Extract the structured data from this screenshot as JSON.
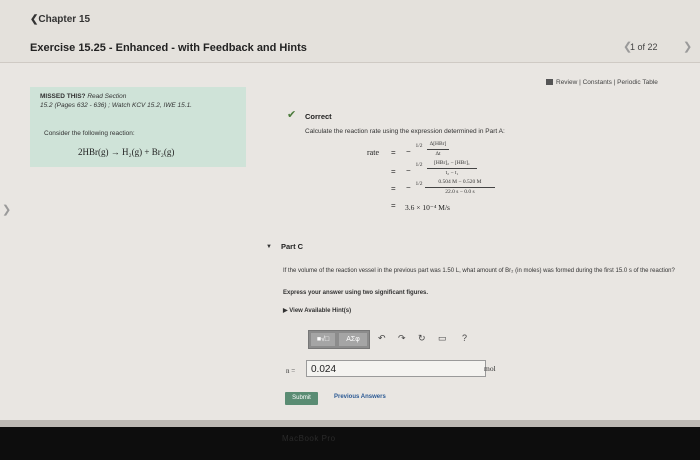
{
  "header": {
    "chapter": "❮Chapter 15",
    "title": "Exercise 15.25 - Enhanced - with Feedback and Hints",
    "pager": "1 of 22",
    "prev_arrow": "❮",
    "next_arrow": "❯"
  },
  "side_arrow": "❯",
  "review_link": "Review | Constants | Periodic Table",
  "missed": {
    "lead": "MISSED THIS?",
    "read": " Read Section",
    "detail": "15.2 (Pages 632 - 636) ; Watch KCV 15.2, IWE 15.1.",
    "consider": "Consider the following reaction:",
    "reaction": "2HBr(g) → H₂(g) + Br₂(g)"
  },
  "correct": {
    "heading": "Correct",
    "text": "Calculate the reaction rate using the expression determined in Part A:",
    "rate_label": "rate",
    "eq_sign": "=",
    "line1_coef": "−",
    "line1_num": "Δ[HBr]",
    "line1_den": "Δt",
    "line2_num": "[HBr]₂ − [HBr]₁",
    "line2_den": "t₂ − t₁",
    "line3_num": "0.504 M − 0.520 M",
    "line3_den": "22.0 s − 0.0 s",
    "result": "3.6 × 10⁻⁴ M/s",
    "half": "1/2"
  },
  "partc": {
    "label": "Part C",
    "question": "If the volume of the reaction vessel in the previous part was 1.50 L, what amount of Br₂ (in moles) was formed during the first 15.0 s of the reaction?",
    "express": "Express your answer using two significant figures.",
    "hints": "View Available Hint(s)",
    "toolbar_btn1": "■√□",
    "toolbar_btn2": "ΑΣφ",
    "undo_icon": "↶",
    "redo_icon": "↷",
    "reset_icon": "↻",
    "keyboard_icon": "▭",
    "help_icon": "?",
    "n_label": "n =",
    "answer_value": "0.024",
    "unit": "mol",
    "submit": "Submit",
    "previous_answers": "Previous Answers"
  },
  "bezel_text": "MacBook Pro"
}
